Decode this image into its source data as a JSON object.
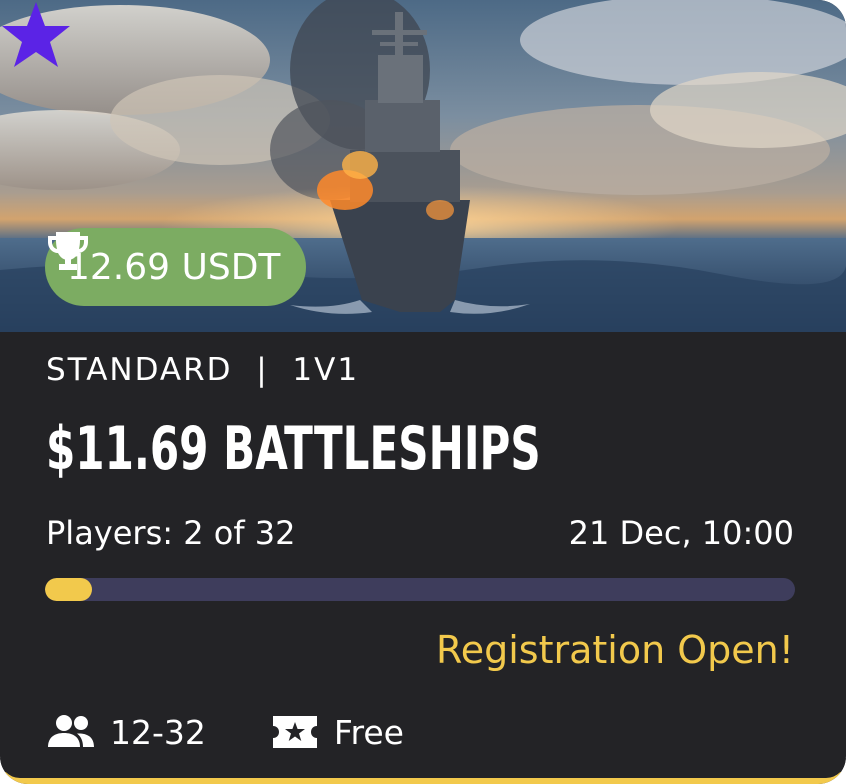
{
  "prize": {
    "amount": "12.69 USDT",
    "icon": "trophy-icon"
  },
  "favorite": {
    "icon": "star-icon",
    "color": "#5b23e6",
    "active": true
  },
  "tournament": {
    "category": "STANDARD  |  1V1",
    "title": "$11.69 BATTLESHIPS",
    "players": "Players: 2 of 32",
    "datetime": "21 Dec, 10:00",
    "progress": 0.0625,
    "status": "Registration Open!"
  },
  "meta": {
    "team_size": {
      "icon": "group-icon",
      "label": "12-32"
    },
    "entry": {
      "icon": "ticket-star-icon",
      "label": "Free"
    }
  },
  "colors": {
    "card_bg": "#232326",
    "accent": "#f2c94c",
    "prize_badge": "#7cac62",
    "progress_track": "#3e3d5c"
  }
}
